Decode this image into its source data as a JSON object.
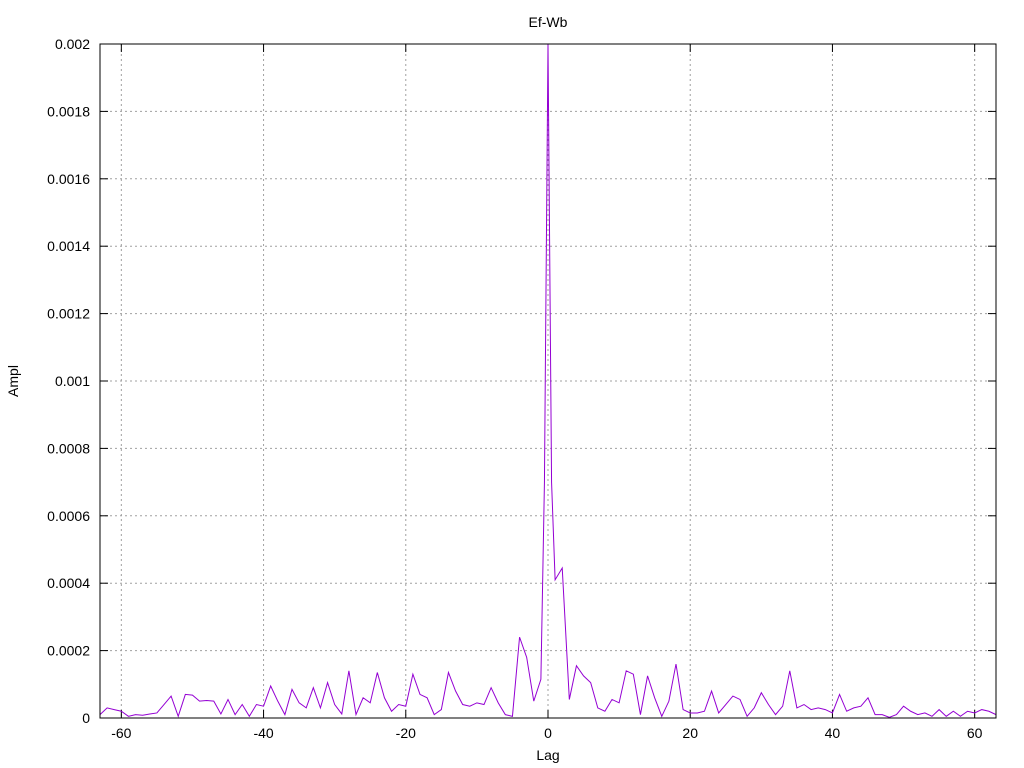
{
  "chart_data": {
    "type": "line",
    "title": "Ef-Wb",
    "xlabel": "Lag",
    "ylabel": "Ampl",
    "xlim": [
      -63,
      63
    ],
    "ylim": [
      0,
      0.002
    ],
    "xticks": [
      -60,
      -40,
      -20,
      0,
      20,
      40,
      60
    ],
    "xtick_labels": [
      "-60",
      "-40",
      "-20",
      "0",
      "20",
      "40",
      "60"
    ],
    "yticks": [
      0,
      0.0002,
      0.0004,
      0.0006,
      0.0008,
      0.001,
      0.0012,
      0.0014,
      0.0016,
      0.0018,
      0.002
    ],
    "ytick_labels": [
      "0",
      "0.0002",
      "0.0004",
      "0.0006",
      "0.0008",
      "0.001",
      "0.0012",
      "0.0014",
      "0.0016",
      "0.0018",
      "0.002"
    ],
    "grid": true,
    "line_color": "#9400d3",
    "series": [
      {
        "x": [
          -63,
          -62,
          -61,
          -60,
          -59,
          -58,
          -57,
          -56,
          -55,
          -54,
          -53,
          -52,
          -51,
          -50,
          -49,
          -48,
          -47,
          -46,
          -45,
          -44,
          -43,
          -42,
          -41,
          -40,
          -39,
          -38,
          -37,
          -36,
          -35,
          -34,
          -33,
          -32,
          -31,
          -30,
          -29,
          -28,
          -27,
          -26,
          -25,
          -24,
          -23,
          -22,
          -21,
          -20,
          -19,
          -18,
          -17,
          -16,
          -15,
          -14,
          -13,
          -12,
          -11,
          -10,
          -9,
          -8,
          -7,
          -6,
          -5,
          -4,
          -3,
          -2,
          -1,
          -0.5,
          0,
          0.5,
          1,
          2,
          3,
          4,
          5,
          6,
          7,
          8,
          9,
          10,
          11,
          12,
          13,
          14,
          15,
          16,
          17,
          18,
          19,
          20,
          21,
          22,
          23,
          24,
          25,
          26,
          27,
          28,
          29,
          30,
          31,
          32,
          33,
          34,
          35,
          36,
          37,
          38,
          39,
          40,
          41,
          42,
          43,
          44,
          45,
          46,
          47,
          48,
          49,
          50,
          51,
          52,
          53,
          54,
          55,
          56,
          57,
          58,
          59,
          60,
          61,
          62,
          63
        ],
        "values": [
          1e-05,
          3e-05,
          2.5e-05,
          2e-05,
          5e-06,
          1e-05,
          8e-06,
          1.2e-05,
          1.5e-05,
          4e-05,
          6.5e-05,
          5e-06,
          7e-05,
          6.8e-05,
          5e-05,
          5.2e-05,
          5e-05,
          1.2e-05,
          5.5e-05,
          1e-05,
          4e-05,
          5e-06,
          4e-05,
          3.5e-05,
          9.5e-05,
          5e-05,
          1e-05,
          8.5e-05,
          4.5e-05,
          3e-05,
          9e-05,
          3e-05,
          0.000105,
          4e-05,
          1.2e-05,
          0.00014,
          1e-05,
          6e-05,
          4.5e-05,
          0.000135,
          6e-05,
          2e-05,
          4e-05,
          3.5e-05,
          0.00013,
          7e-05,
          6e-05,
          1e-05,
          2.5e-05,
          0.000135,
          8e-05,
          4e-05,
          3.5e-05,
          4.5e-05,
          4e-05,
          9e-05,
          4.5e-05,
          1e-05,
          5e-06,
          0.00024,
          0.00018,
          5e-05,
          0.000115,
          0.0007,
          0.002,
          0.0007,
          0.00041,
          0.000445,
          5.5e-05,
          0.000155,
          0.000125,
          0.000105,
          3e-05,
          2e-05,
          5.5e-05,
          4.5e-05,
          0.00014,
          0.00013,
          1e-05,
          0.000125,
          6e-05,
          5e-06,
          5e-05,
          0.00016,
          2.5e-05,
          1.5e-05,
          1.5e-05,
          2e-05,
          8e-05,
          1.5e-05,
          4e-05,
          6.5e-05,
          5.5e-05,
          5e-06,
          3e-05,
          7.5e-05,
          4e-05,
          1e-05,
          3.5e-05,
          0.00014,
          3e-05,
          4e-05,
          2.5e-05,
          3e-05,
          2.5e-05,
          1.5e-05,
          7e-05,
          2e-05,
          3e-05,
          3.5e-05,
          6e-05,
          1e-05,
          1e-05,
          2e-06,
          1e-05,
          3.5e-05,
          2e-05,
          1e-05,
          1.5e-05,
          5e-06,
          2.5e-05,
          5e-06,
          2e-05,
          5e-06,
          2e-05,
          1.5e-05,
          2.5e-05,
          2e-05,
          1e-05
        ]
      }
    ]
  }
}
